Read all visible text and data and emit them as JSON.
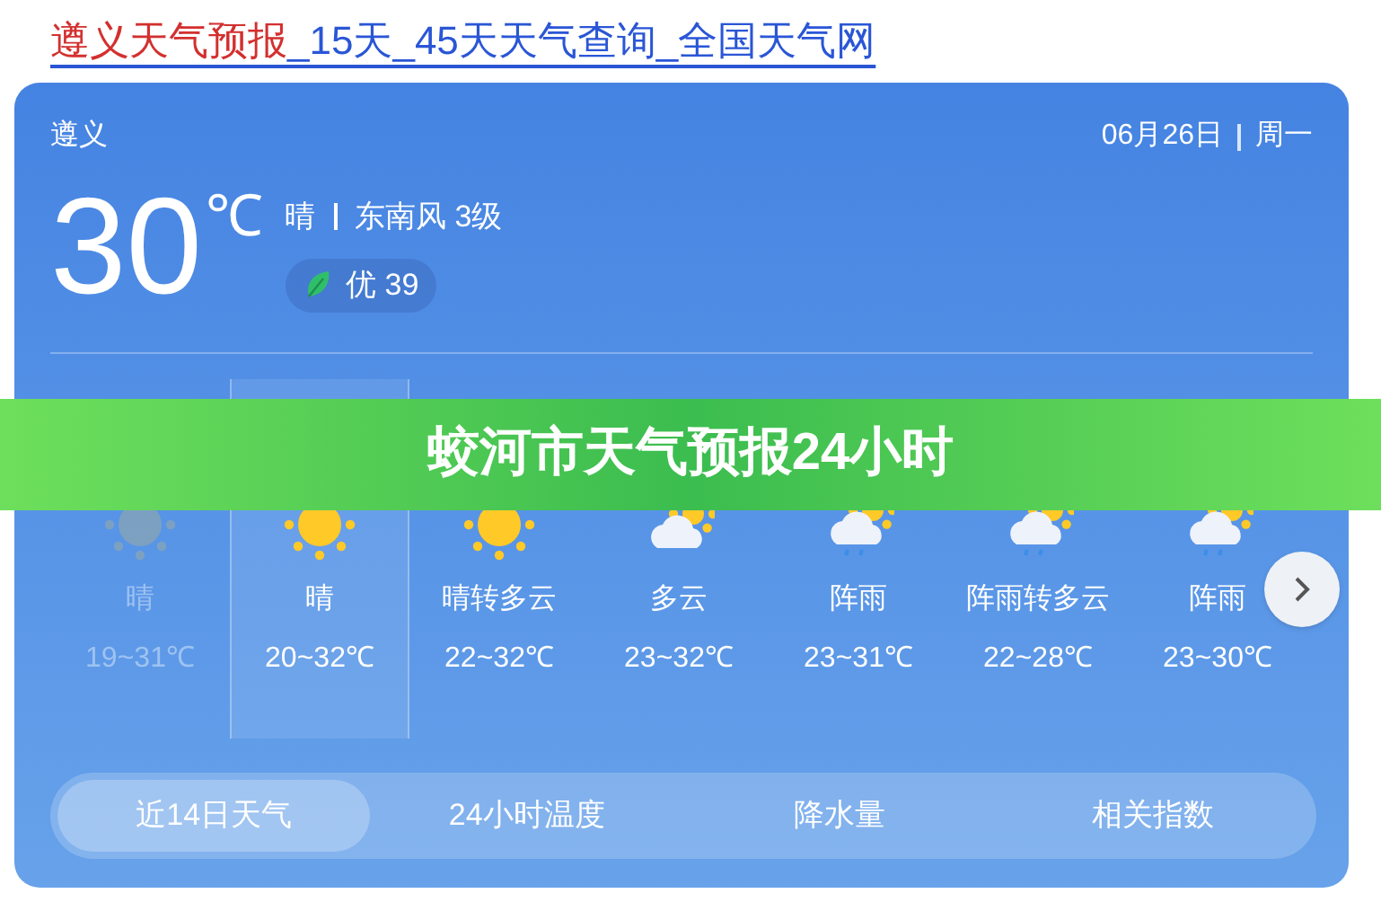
{
  "headline": {
    "highlight": "遵义天气预报",
    "rest": "_15天_45天天气查询_全国天气网"
  },
  "card": {
    "city": "遵义",
    "date": "06月26日",
    "weekday": "周一",
    "temperature": "30",
    "unit": "℃",
    "condition": "晴",
    "wind": "东南风 3级",
    "aqi": "优 39"
  },
  "days": [
    {
      "kind": "sunny",
      "condition": "晴",
      "range": "19~31℃",
      "past": true,
      "selected": false
    },
    {
      "kind": "sunny",
      "condition": "晴",
      "range": "20~32℃",
      "past": false,
      "selected": true
    },
    {
      "kind": "sunny",
      "condition": "晴转多云",
      "range": "22~32℃",
      "past": false,
      "selected": false
    },
    {
      "kind": "cloudy",
      "condition": "多云",
      "range": "23~32℃",
      "past": false,
      "selected": false
    },
    {
      "kind": "rain",
      "condition": "阵雨",
      "range": "23~31℃",
      "past": false,
      "selected": false
    },
    {
      "kind": "rain",
      "condition": "阵雨转多云",
      "range": "22~28℃",
      "past": false,
      "selected": false
    },
    {
      "kind": "rain",
      "condition": "阵雨",
      "range": "23~30℃",
      "past": false,
      "selected": false
    }
  ],
  "tabs": [
    {
      "label": "近14日天气",
      "selected": true
    },
    {
      "label": "24小时温度",
      "selected": false
    },
    {
      "label": "降水量",
      "selected": false
    },
    {
      "label": "相关指数",
      "selected": false
    }
  ],
  "banner": {
    "title": "蛟河市天气预报24小时"
  }
}
